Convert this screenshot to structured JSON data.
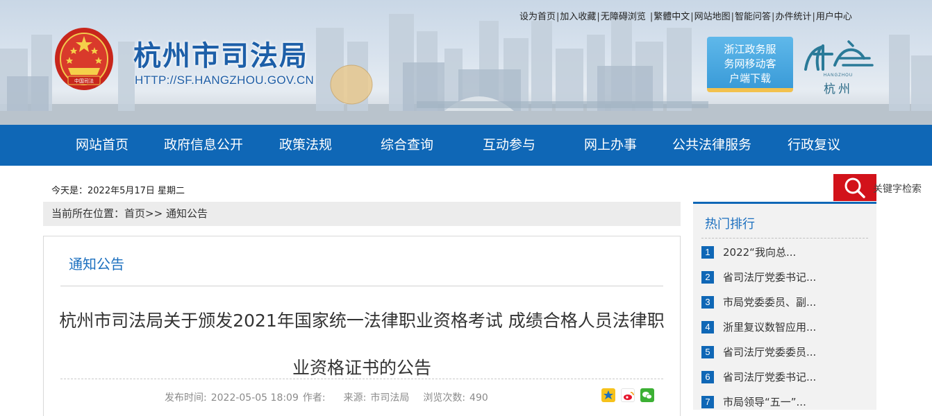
{
  "header": {
    "site_title": "杭州市司法局",
    "site_url": "HTTP://SF.HANGZHOU.GOV.CN",
    "emblem_text": "中国司法",
    "top_links": [
      "设为首页",
      "加入收藏",
      "无障碍浏览",
      "繁體中文",
      "网站地图",
      "智能问答",
      "办件统计",
      "用户中心"
    ],
    "app_download": [
      "浙江政务服",
      "务网移动客",
      "户端下载"
    ],
    "city_logo_sub": "HANGZHOU",
    "city_logo_name": "杭州"
  },
  "nav": [
    "网站首页",
    "政府信息公开",
    "政策法规",
    "综合查询",
    "互动参与",
    "网上办事",
    "公共法律服务",
    "行政复议"
  ],
  "today": "今天是：2022年5月17日  星期二",
  "search": {
    "label": "关键字检索",
    "icon": "search-icon"
  },
  "breadcrumb": {
    "prefix": "当前所在位置：",
    "home": "首页",
    "sep": ">>",
    "current": "通知公告"
  },
  "article": {
    "section": "通知公告",
    "title": "杭州市司法局关于颁发2021年国家统一法律职业资格考试 成绩合格人员法律职业资格证书的公告",
    "meta": {
      "publish_label": "发布时间:",
      "publish_value": "2022-05-05 18:09",
      "author_label": "作者:",
      "author_value": "",
      "source_label": "来源:",
      "source_value": "市司法局",
      "views_label": "浏览次数:",
      "views_value": "490"
    },
    "share_icons": [
      "qzone-icon",
      "weibo-icon",
      "wechat-icon"
    ]
  },
  "hot": {
    "title": "热门排行",
    "items": [
      {
        "rank": "1",
        "text": "2022“我向总..."
      },
      {
        "rank": "2",
        "text": "省司法厅党委书记..."
      },
      {
        "rank": "3",
        "text": "市局党委委员、副..."
      },
      {
        "rank": "4",
        "text": "浙里复议数智应用..."
      },
      {
        "rank": "5",
        "text": "省司法厅党委委员..."
      },
      {
        "rank": "6",
        "text": "省司法厅党委书记..."
      },
      {
        "rank": "7",
        "text": "市局领导“五一”..."
      }
    ]
  },
  "colors": {
    "nav": "#0f67b6",
    "accent": "#1b6fbf",
    "search": "#d2121a"
  }
}
